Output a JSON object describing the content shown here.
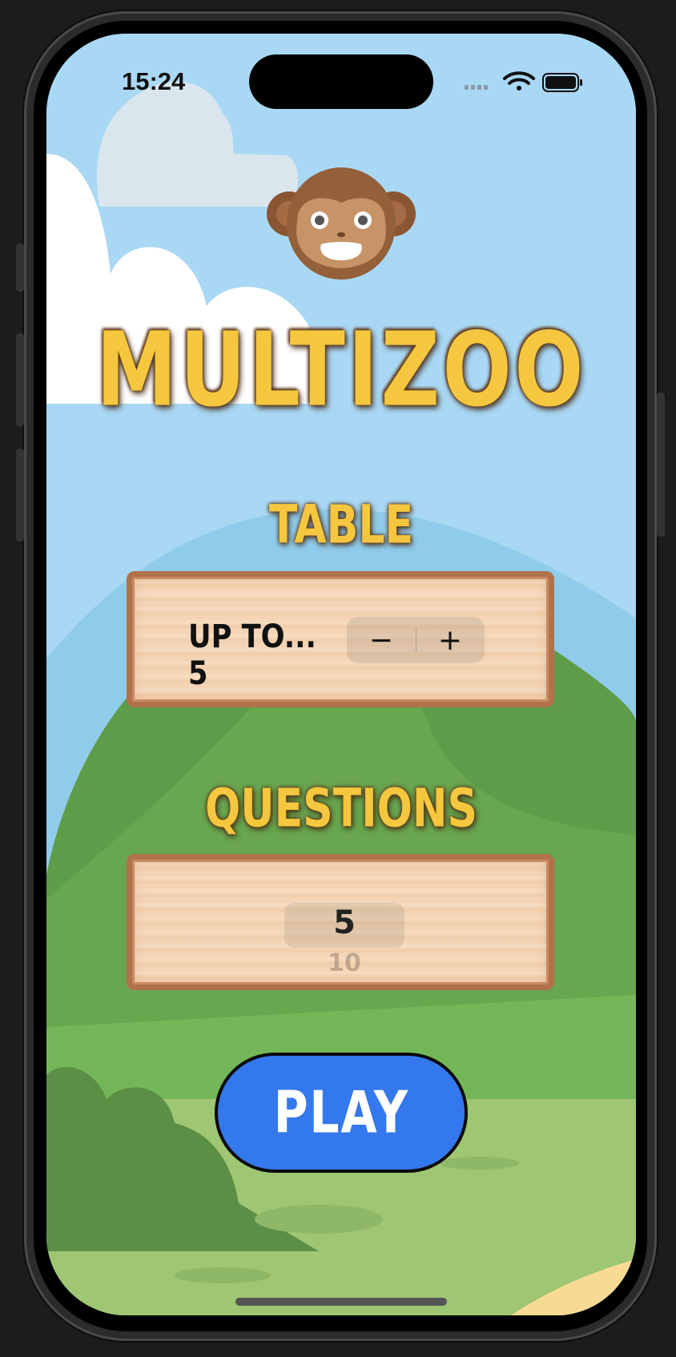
{
  "status_bar": {
    "time": "15:24",
    "icons": [
      "cellular-signal-icon",
      "wifi-icon",
      "battery-icon"
    ]
  },
  "app": {
    "mascot_icon": "monkey-face-icon",
    "title": "MULTIZOO"
  },
  "table_section": {
    "label": "TABLE",
    "stepper_label": "UP TO... 5",
    "decrement_symbol": "−",
    "increment_symbol": "+"
  },
  "questions_section": {
    "label": "QUESTIONS",
    "picker_selected": "5",
    "picker_next": "10"
  },
  "play_button": {
    "label": "PLAY",
    "color": "#3478ee"
  },
  "colors": {
    "title_fill": "#f5c73f",
    "title_outline": "#5b3a1c",
    "plank_wood": "#f3d2b3",
    "sky": "#a9d8f4",
    "hill_green": "#5f9c49"
  }
}
